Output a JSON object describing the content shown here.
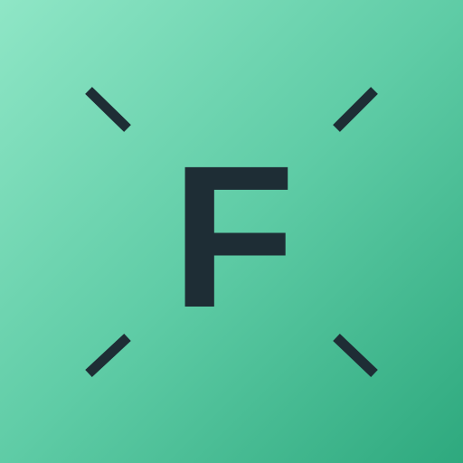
{
  "icon": {
    "letter": "F",
    "icon_name": "f-app-icon",
    "colors": {
      "gradient_light": "#8fe6c6",
      "gradient_mid": "#5fcca6",
      "gradient_dark": "#2ea97e",
      "mark": "#1e2d35"
    }
  }
}
